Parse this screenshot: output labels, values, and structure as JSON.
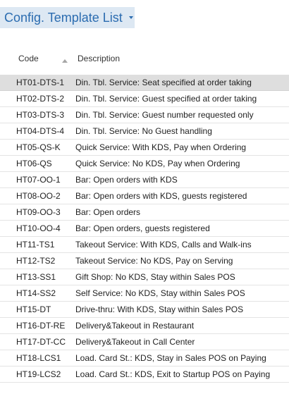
{
  "page": {
    "title": "Config. Template List"
  },
  "columns": {
    "code": "Code",
    "description": "Description",
    "sort": "ascending"
  },
  "rows": [
    {
      "code": "HT01-DTS-1",
      "description": "Din. Tbl. Service: Seat specified at order taking",
      "selected": true
    },
    {
      "code": "HT02-DTS-2",
      "description": "Din. Tbl. Service: Guest specified at order taking"
    },
    {
      "code": "HT03-DTS-3",
      "description": "Din. Tbl. Service: Guest number requested only"
    },
    {
      "code": "HT04-DTS-4",
      "description": "Din. Tbl. Service: No Guest handling"
    },
    {
      "code": "HT05-QS-K",
      "description": "Quick Service: With KDS, Pay when Ordering"
    },
    {
      "code": "HT06-QS",
      "description": "Quick Service: No KDS, Pay when Ordering"
    },
    {
      "code": "HT07-OO-1",
      "description": "Bar: Open orders with KDS"
    },
    {
      "code": "HT08-OO-2",
      "description": "Bar: Open orders with KDS, guests registered"
    },
    {
      "code": "HT09-OO-3",
      "description": "Bar: Open orders"
    },
    {
      "code": "HT10-OO-4",
      "description": "Bar: Open orders, guests registered"
    },
    {
      "code": "HT11-TS1",
      "description": "Takeout Service: With KDS, Calls and Walk-ins"
    },
    {
      "code": "HT12-TS2",
      "description": "Takeout Service: No KDS, Pay on Serving"
    },
    {
      "code": "HT13-SS1",
      "description": "Gift Shop: No KDS, Stay within Sales POS"
    },
    {
      "code": "HT14-SS2",
      "description": "Self Service: No KDS, Stay within Sales POS"
    },
    {
      "code": "HT15-DT",
      "description": "Drive-thru: With KDS, Stay within Sales POS"
    },
    {
      "code": "HT16-DT-RE",
      "description": "Delivery&Takeout in Restaurant"
    },
    {
      "code": "HT17-DT-CC",
      "description": "Delivery&Takeout in Call Center"
    },
    {
      "code": "HT18-LCS1",
      "description": "Load. Card St.: KDS, Stay in Sales POS on Paying"
    },
    {
      "code": "HT19-LCS2",
      "description": "Load. Card St.: KDS, Exit to Startup POS on Paying"
    }
  ],
  "colors": {
    "title_text": "#2b6cb0",
    "title_background": "#dde8f3",
    "selected_row": "#dedede"
  }
}
